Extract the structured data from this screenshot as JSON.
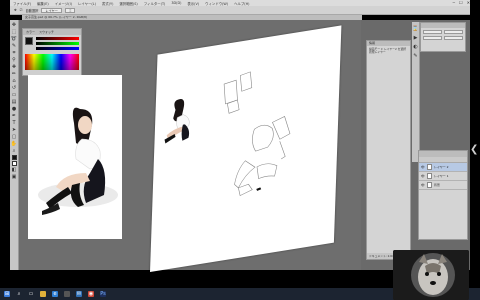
{
  "menubar": {
    "items": [
      "ファイル(F)",
      "編集(E)",
      "イメージ(I)",
      "レイヤー(L)",
      "書式(Y)",
      "選択範囲(S)",
      "フィルター(T)",
      "3D(D)",
      "表示(V)",
      "ウィンドウ(W)",
      "ヘルプ(H)"
    ]
  },
  "optionsbar": {
    "mode_label": "自動選択",
    "mode_value": "レイヤー"
  },
  "title_controls": {
    "minimize": "─",
    "maximize": "☐",
    "close": "✕"
  },
  "document_tab": {
    "label": "女子高生.psd @ 66.7% (レイヤー 2, RGB/8)"
  },
  "color_panel": {
    "tab1": "カラー",
    "tab2": "スウォッチ"
  },
  "info_panel": {
    "title": "情報",
    "text": "描画モード レイヤー2 を選択 新規レイヤー",
    "footer": "ドキュメント: 2.64M/4.03M"
  },
  "layers_panel": {
    "rows": [
      {
        "label": "レイヤー 2",
        "selected": true
      },
      {
        "label": "レイヤー 1",
        "selected": false
      },
      {
        "label": "背景",
        "selected": false
      }
    ]
  },
  "taskbar": {
    "icons": [
      "windows-icon",
      "search-icon",
      "taskview-icon",
      "explorer-icon",
      "edge-icon",
      "store-icon",
      "mail-icon",
      "chrome-icon",
      "photoshop-icon"
    ]
  },
  "tray": {
    "time": "",
    "date": ""
  },
  "colors": {
    "workspace": "#6e6e6e",
    "accent": "#b7c9e4"
  }
}
